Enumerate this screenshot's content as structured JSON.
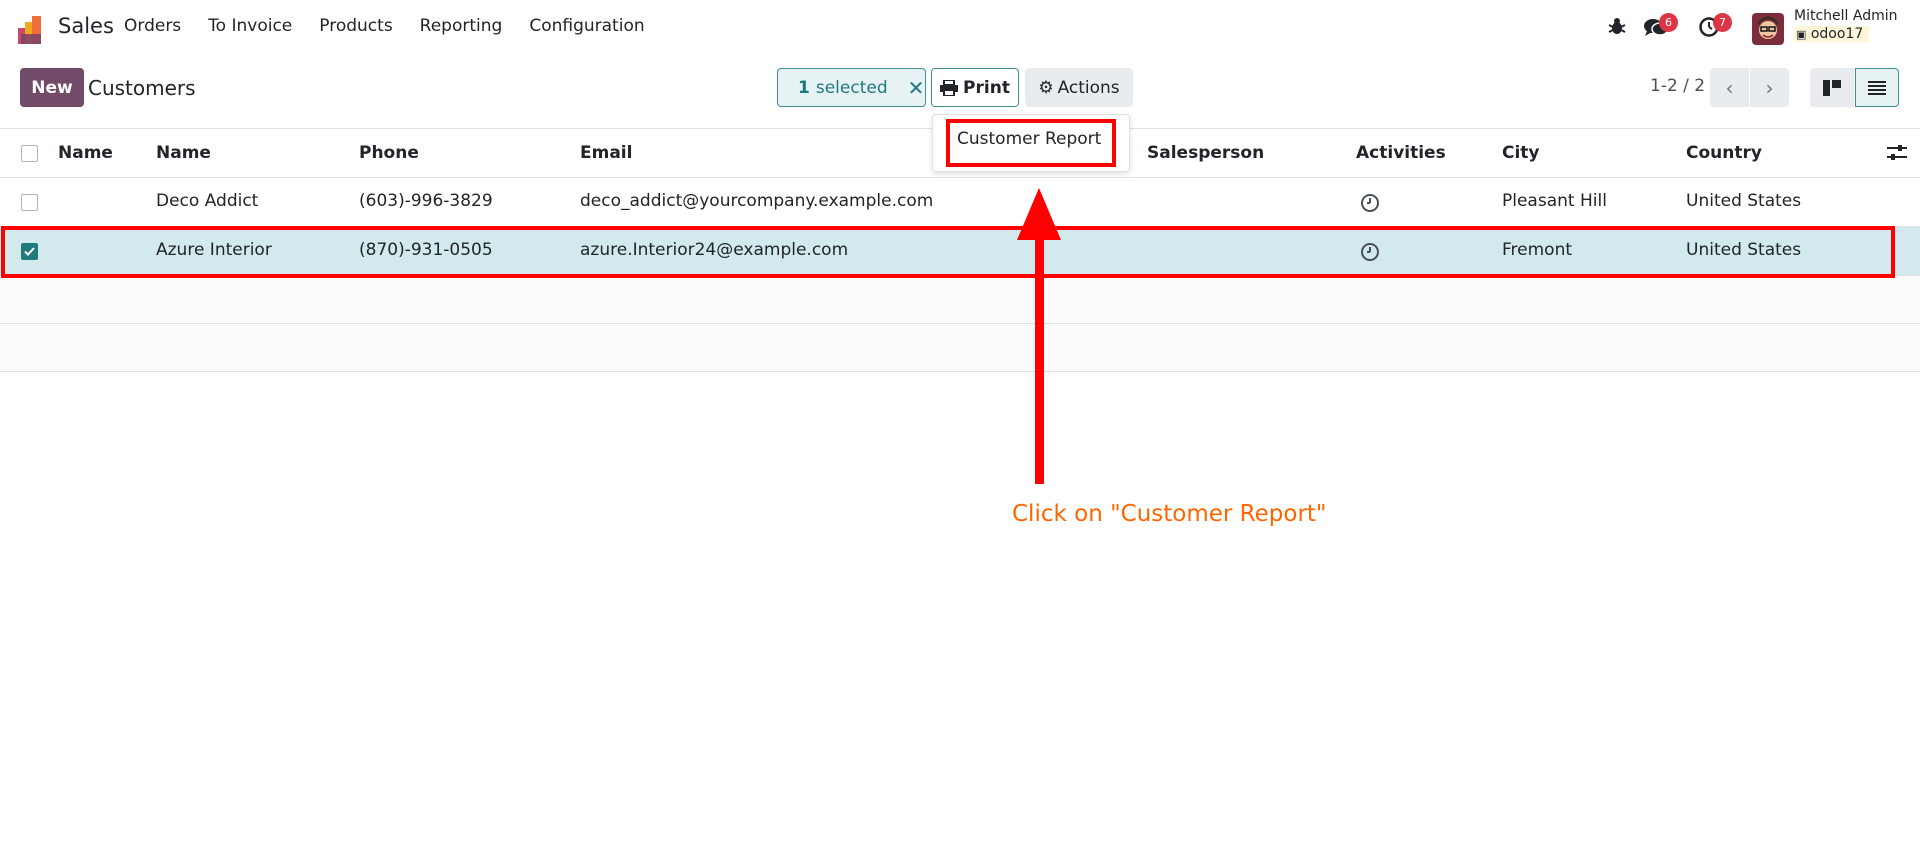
{
  "app": {
    "name": "Sales"
  },
  "menu": [
    "Orders",
    "To Invoice",
    "Products",
    "Reporting",
    "Configuration"
  ],
  "systray": {
    "messages_count": "6",
    "activities_count": "7",
    "user_name": "Mitchell Admin",
    "database": "odoo17"
  },
  "control": {
    "new_label": "New",
    "title": "Customers",
    "selected_count": "1",
    "selected_label": "selected",
    "print_label": "Print",
    "actions_label": "Actions",
    "pager": "1-2 / 2"
  },
  "dropdown": {
    "item": "Customer Report"
  },
  "table": {
    "headers": [
      "Name",
      "Name",
      "Phone",
      "Email",
      "Salesperson",
      "Activities",
      "City",
      "Country"
    ],
    "rows": [
      {
        "name": "Deco Addict",
        "phone": "(603)-996-3829",
        "email": "deco_addict@yourcompany.example.com",
        "city": "Pleasant Hill",
        "country": "United States",
        "checked": false
      },
      {
        "name": "Azure Interior",
        "phone": "(870)-931-0505",
        "email": "azure.Interior24@example.com",
        "city": "Fremont",
        "country": "United States",
        "checked": true
      }
    ]
  },
  "annotation": {
    "text": "Click on \"Customer Report\""
  },
  "colors": {
    "brand": "#714b67",
    "accent": "#1f7a7c",
    "highlight": "#ff0000",
    "annotation": "#ff6600",
    "selected_row": "#d2e9ed"
  }
}
